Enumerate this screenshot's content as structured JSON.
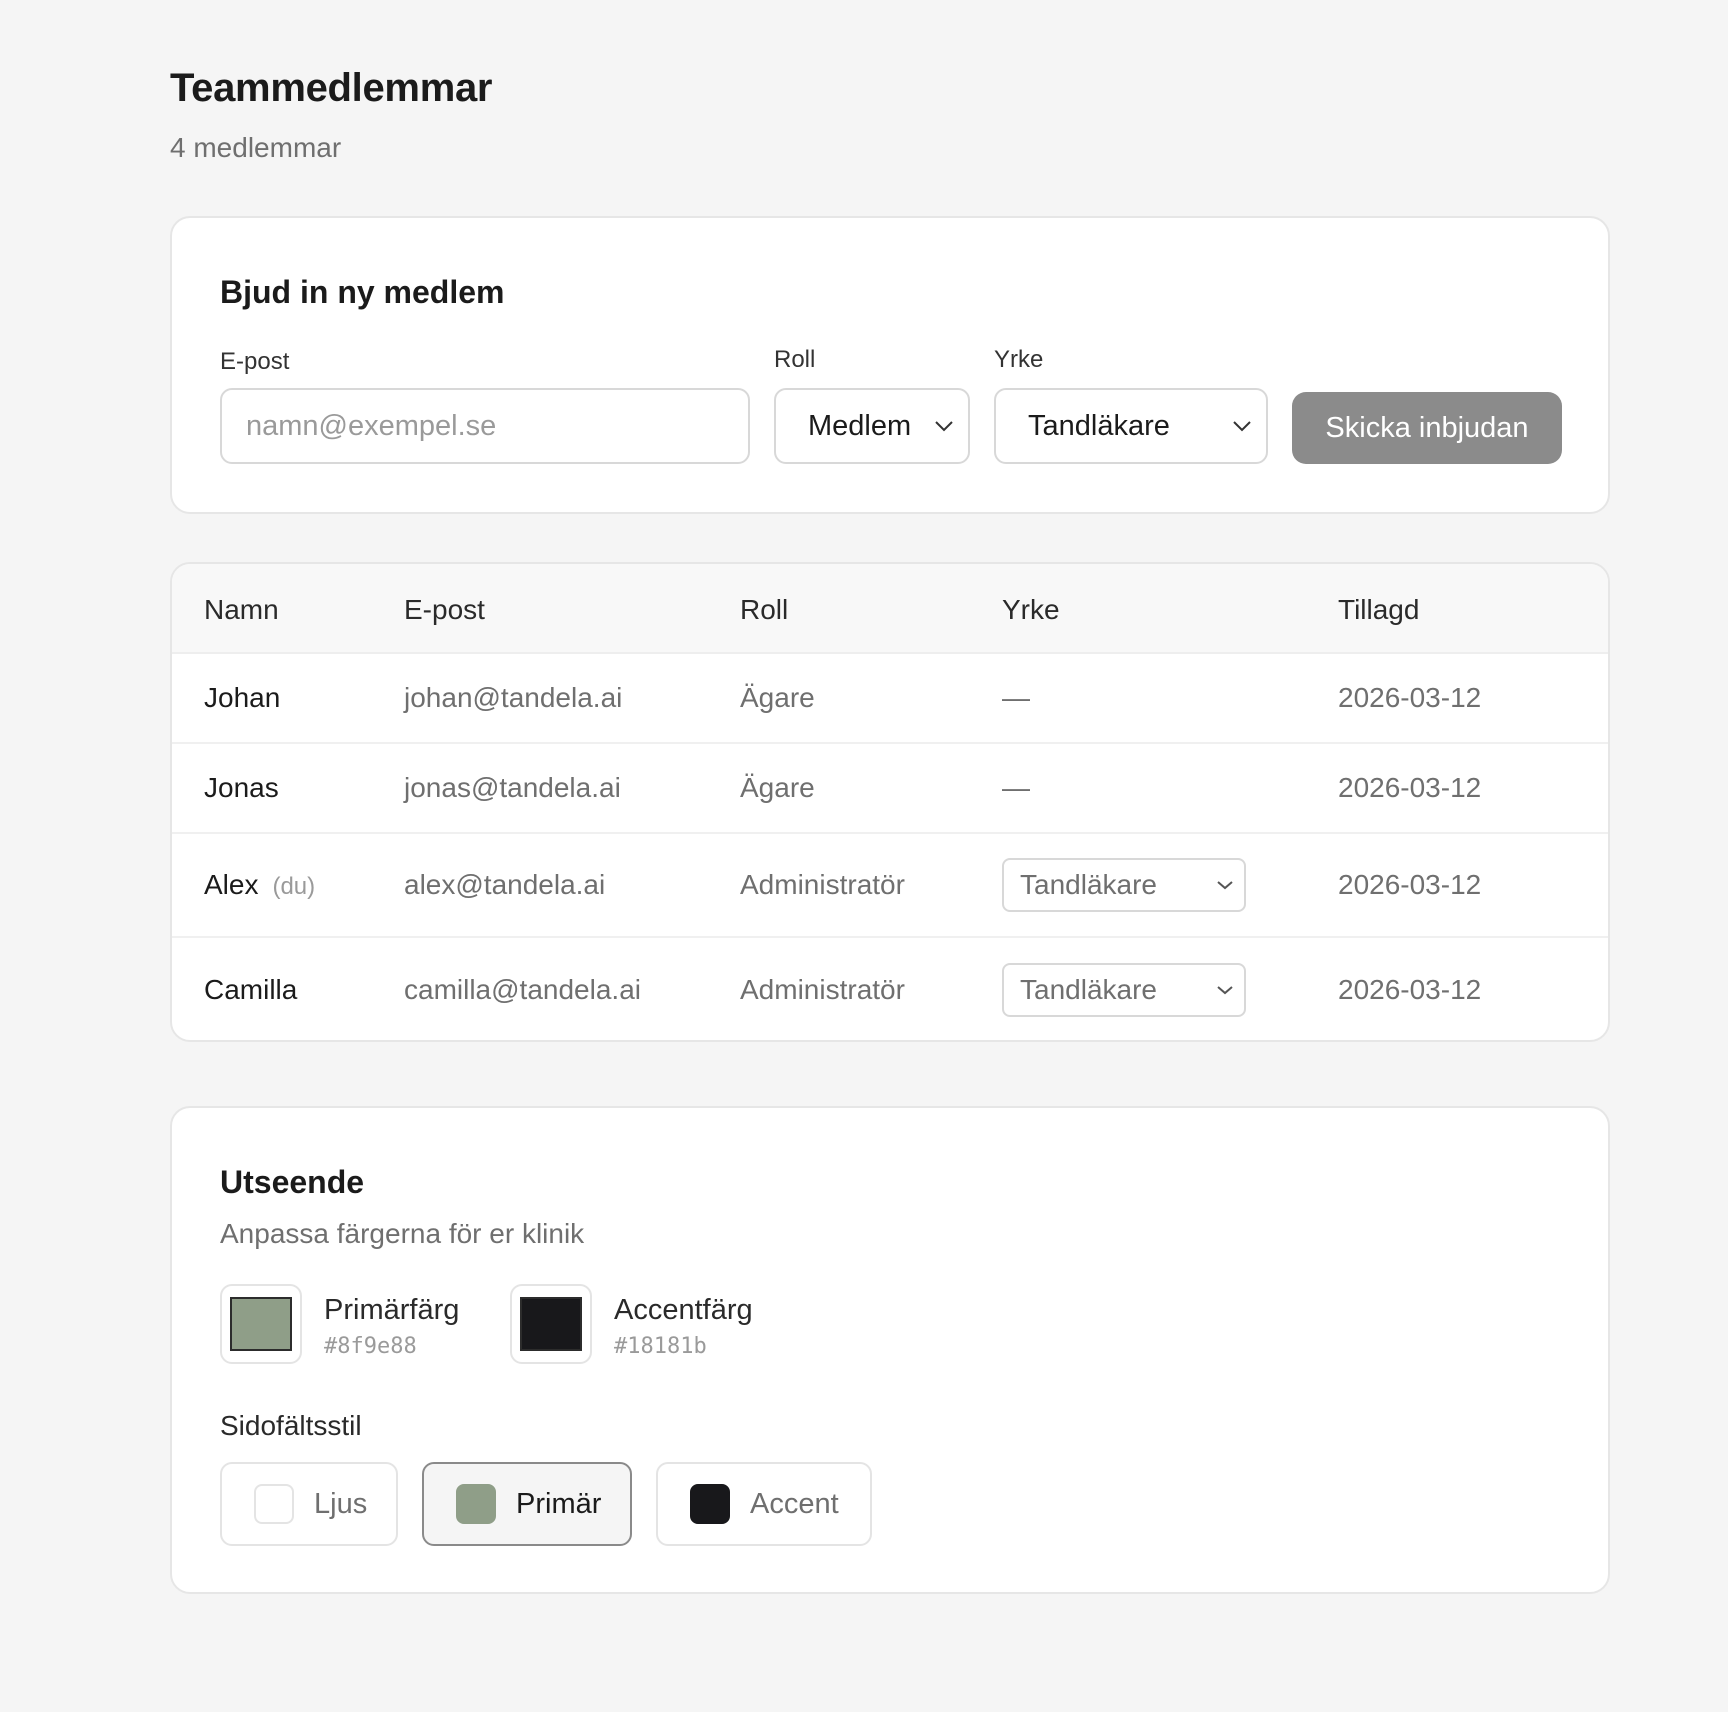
{
  "header": {
    "title": "Teammedlemmar",
    "subtitle": "4 medlemmar"
  },
  "invite": {
    "title": "Bjud in ny medlem",
    "email_label": "E-post",
    "email_placeholder": "namn@exempel.se",
    "email_value": "",
    "role_label": "Roll",
    "role_value": "Medlem",
    "profession_label": "Yrke",
    "profession_value": "Tandläkare",
    "submit_label": "Skicka inbjudan"
  },
  "members_table": {
    "columns": [
      "Namn",
      "E-post",
      "Roll",
      "Yrke",
      "Tillagd"
    ],
    "rows": [
      {
        "name": "Johan",
        "you_tag": "",
        "email": "johan@tandela.ai",
        "role": "Ägare",
        "profession": "—",
        "added": "2026-03-12"
      },
      {
        "name": "Jonas",
        "you_tag": "",
        "email": "jonas@tandela.ai",
        "role": "Ägare",
        "profession": "—",
        "added": "2026-03-12"
      },
      {
        "name": "Alex",
        "you_tag": "(du)",
        "email": "alex@tandela.ai",
        "role": "Administratör",
        "profession": "Tandläkare",
        "added": "2026-03-12"
      },
      {
        "name": "Camilla",
        "you_tag": "",
        "email": "camilla@tandela.ai",
        "role": "Administratör",
        "profession": "Tandläkare",
        "added": "2026-03-12"
      }
    ]
  },
  "appearance": {
    "title": "Utseende",
    "subtitle": "Anpassa färgerna för er klinik",
    "primary": {
      "label": "Primärfärg",
      "hex": "#8f9e88"
    },
    "accent": {
      "label": "Accentfärg",
      "hex": "#18181b"
    },
    "sidebar_style_label": "Sidofältsstil",
    "sidebar_options": [
      {
        "label": "Ljus",
        "color": "#ffffff",
        "selected": false
      },
      {
        "label": "Primär",
        "color": "#8f9e88",
        "selected": true
      },
      {
        "label": "Accent",
        "color": "#18181b",
        "selected": false
      }
    ]
  },
  "colors": {
    "button_disabled": "#8b8b8b",
    "page_background": "#f5f5f5"
  }
}
